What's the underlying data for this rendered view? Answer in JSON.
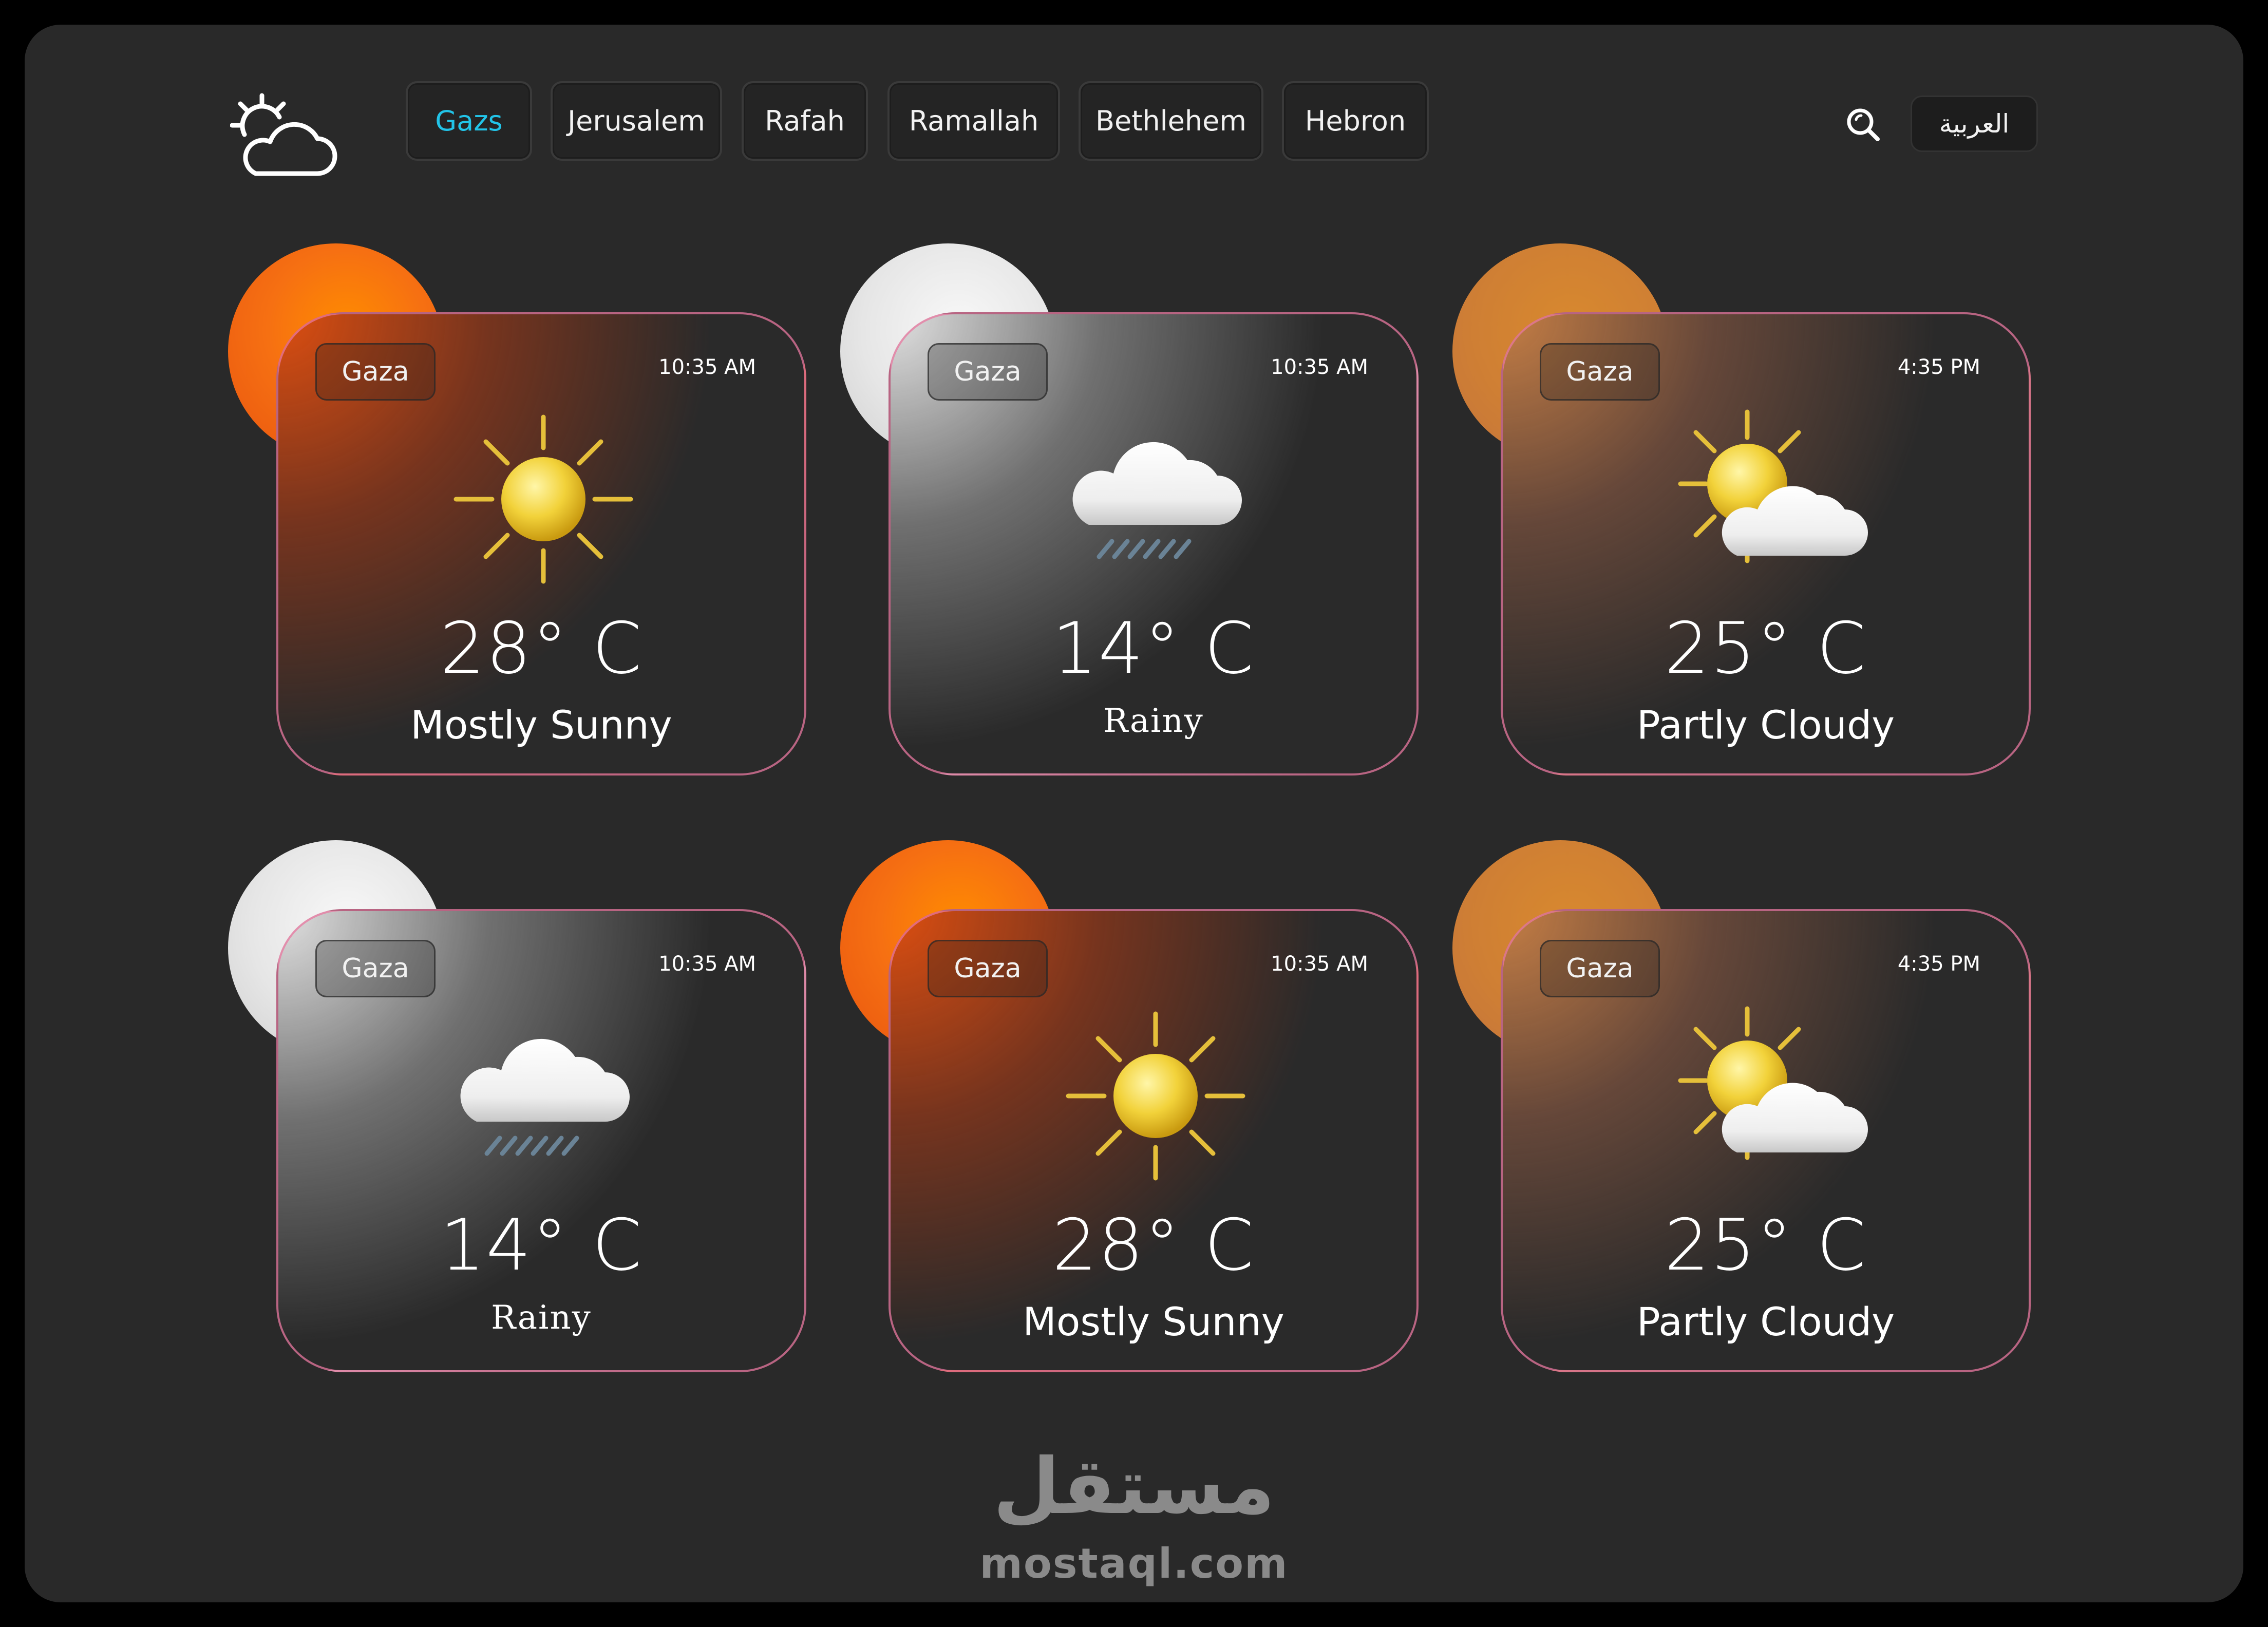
{
  "header": {
    "logo_icon": "partly-cloudy-logo-icon",
    "tabs": [
      {
        "label": "Gazs",
        "active": true
      },
      {
        "label": "Jerusalem",
        "active": false
      },
      {
        "label": "Rafah",
        "active": false
      },
      {
        "label": "Ramallah",
        "active": false
      },
      {
        "label": "Bethlehem",
        "active": false
      },
      {
        "label": "Hebron",
        "active": false
      }
    ],
    "search_icon": "search-icon",
    "language_label": "العربية"
  },
  "cards": [
    {
      "city": "Gaza",
      "time": "10:35 AM",
      "temp": "28° C",
      "condition": "Mostly Sunny",
      "icon": "sun-icon"
    },
    {
      "city": "Gaza",
      "time": "10:35 AM",
      "temp": "14° C",
      "condition": "Rainy",
      "icon": "rain-cloud-icon"
    },
    {
      "city": "Gaza",
      "time": "4:35 PM",
      "temp": "25° C",
      "condition": "Partly Cloudy",
      "icon": "partly-cloudy-icon"
    },
    {
      "city": "Gaza",
      "time": "10:35 AM",
      "temp": "14° C",
      "condition": "Rainy",
      "icon": "rain-cloud-icon"
    },
    {
      "city": "Gaza",
      "time": "10:35 AM",
      "temp": "28° C",
      "condition": "Mostly Sunny",
      "icon": "sun-icon"
    },
    {
      "city": "Gaza",
      "time": "4:35 PM",
      "temp": "25° C",
      "condition": "Partly Cloudy",
      "icon": "partly-cloudy-icon"
    }
  ],
  "watermark": {
    "arabic": "مستقل",
    "latin": "mostaql.com"
  },
  "colors": {
    "background": "#292929",
    "active_tab": "#22c4e8",
    "sunny_orb": "#f67012",
    "rainy_orb": "#e6e6e6",
    "cloudy_orb": "#cf7f34",
    "card_border": "#e878a0"
  }
}
